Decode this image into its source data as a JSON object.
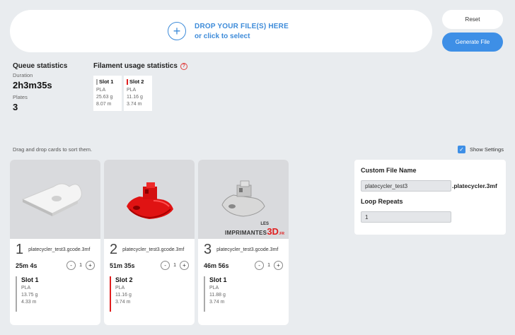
{
  "dropzone": {
    "line1": "DROP YOUR FILE(S) HERE",
    "line2": "or click to select",
    "icon": "plus-icon"
  },
  "buttons": {
    "reset": "Reset",
    "generate": "Generate File"
  },
  "queue_stats": {
    "title": "Queue statistics",
    "duration_label": "Duration",
    "duration_value": "2h3m35s",
    "plates_label": "Plates",
    "plates_value": "3"
  },
  "filament_stats": {
    "title": "Filament usage statistics",
    "help_icon": "?",
    "slots": [
      {
        "name": "Slot 1",
        "type": "PLA",
        "weight": "25.63 g",
        "length": "8.07 m",
        "color": "#ffffff"
      },
      {
        "name": "Slot 2",
        "type": "PLA",
        "weight": "11.16 g",
        "length": "3.74 m",
        "color": "#e01e1e"
      }
    ]
  },
  "drag_hint": "Drag and drop cards to sort them.",
  "show_settings": {
    "label": "Show Settings",
    "checked": true,
    "check": "✓"
  },
  "plates": [
    {
      "number": "1",
      "file": "platecycler_test3.gcode.3mf",
      "time": "25m 4s",
      "repeat": "1",
      "minus": "-",
      "plus": "+",
      "slot": {
        "name": "Slot 1",
        "type": "PLA",
        "weight": "13.75 g",
        "length": "4.33 m",
        "color": "#ffffff"
      }
    },
    {
      "number": "2",
      "file": "platecycler_test3.gcode.3mf",
      "time": "51m 35s",
      "repeat": "1",
      "minus": "-",
      "plus": "+",
      "slot": {
        "name": "Slot 2",
        "type": "PLA",
        "weight": "11.16 g",
        "length": "3.74 m",
        "color": "#e01e1e"
      }
    },
    {
      "number": "3",
      "file": "platecycler_test3.gcode.3mf",
      "time": "46m 56s",
      "repeat": "1",
      "minus": "-",
      "plus": "+",
      "slot": {
        "name": "Slot 1",
        "type": "PLA",
        "weight": "11.88 g",
        "length": "3.74 m",
        "color": "#ffffff"
      },
      "watermark": {
        "top": "LES",
        "main": "IMPRIMANTES",
        "accent": "3D",
        "suffix": ".FR"
      }
    }
  ],
  "settings": {
    "file_name_label": "Custom File Name",
    "file_name_value": "platecycler_test3",
    "file_name_suffix": ".platecycler.3mf",
    "loop_label": "Loop Repeats",
    "loop_value": "1"
  }
}
